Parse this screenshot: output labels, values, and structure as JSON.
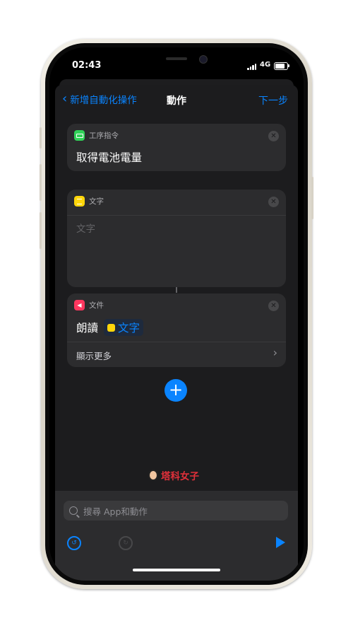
{
  "status": {
    "time": "02:43",
    "network": "4G"
  },
  "nav": {
    "back_label": "新增自動化操作",
    "title": "動作",
    "next_label": "下一步"
  },
  "cards": {
    "battery": {
      "category": "工序指令",
      "action": "取得電池電量"
    },
    "text": {
      "category": "文字",
      "placeholder": "文字"
    },
    "speak": {
      "category": "文件",
      "action": "朗讀",
      "token": "文字",
      "show_more": "顯示更多"
    }
  },
  "brand": {
    "name": "塔科女子"
  },
  "search": {
    "placeholder": "搜尋 App和動作"
  },
  "colors": {
    "accent": "#0a84ff",
    "background": "#1c1c1e",
    "card": "#2c2c2e",
    "battery_icon": "#30d158",
    "text_icon": "#ffd60a",
    "speak_icon": "#ff375f"
  },
  "icons": [
    "chevron-left-icon",
    "close-icon",
    "plus-icon",
    "search-icon",
    "undo-icon",
    "redo-icon",
    "play-icon",
    "battery-icon",
    "cellular-signal-icon"
  ]
}
